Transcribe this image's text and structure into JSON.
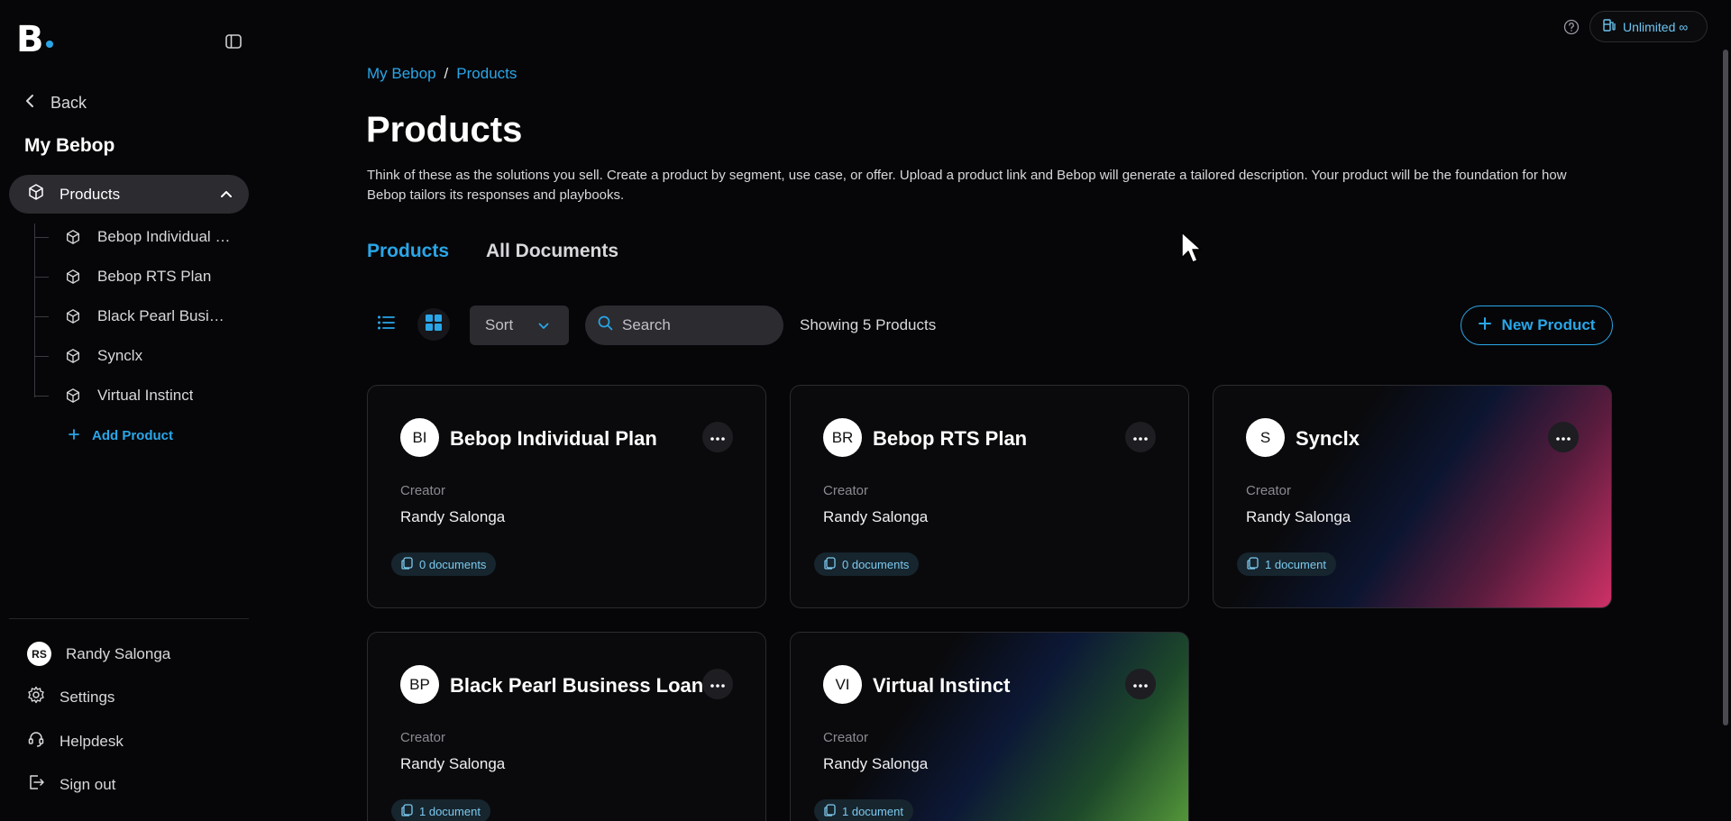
{
  "sidebar": {
    "back_label": "Back",
    "section_title": "My Bebop",
    "active_item": "Products",
    "tree_items": [
      "Bebop Individual Plan",
      "Bebop RTS Plan",
      "Black Pearl Business Loans",
      "Synclx",
      "Virtual Instinct"
    ],
    "add_product": "Add Product",
    "user": {
      "initials": "RS",
      "name": "Randy Salonga"
    },
    "settings": "Settings",
    "helpdesk": "Helpdesk",
    "sign_out": "Sign out"
  },
  "topbar": {
    "plan_label": "Unlimited ∞"
  },
  "breadcrumb": [
    "My Bebop",
    "Products"
  ],
  "page": {
    "title": "Products",
    "description": "Think of these as the solutions you sell. Create a product by segment, use case, or offer. Upload a product link and Bebop will generate a tailored description. Your product will be the foundation for how Bebop tailors its responses and playbooks."
  },
  "tabs": [
    "Products",
    "All Documents"
  ],
  "toolbar": {
    "sort_label": "Sort",
    "search_placeholder": "Search",
    "showing_text": "Showing 5 Products",
    "new_product_label": "New Product"
  },
  "cards": [
    {
      "initials": "BI",
      "title": "Bebop Individual Plan",
      "creator_label": "Creator",
      "creator": "Randy Salonga",
      "documents": "0 documents"
    },
    {
      "initials": "BR",
      "title": "Bebop RTS Plan",
      "creator_label": "Creator",
      "creator": "Randy Salonga",
      "documents": "0 documents"
    },
    {
      "initials": "S",
      "title": "Synclx",
      "creator_label": "Creator",
      "creator": "Randy Salonga",
      "documents": "1 document"
    },
    {
      "initials": "BP",
      "title": "Black Pearl Business Loans",
      "creator_label": "Creator",
      "creator": "Randy Salonga",
      "documents": "1 document"
    },
    {
      "initials": "VI",
      "title": "Virtual Instinct",
      "creator_label": "Creator",
      "creator": "Randy Salonga",
      "documents": "1 document"
    }
  ],
  "colors": {
    "accent": "#2aa6e8",
    "background": "#060608",
    "card_gradient_pink": "#cf3166",
    "card_gradient_green": "#5ea53c"
  }
}
